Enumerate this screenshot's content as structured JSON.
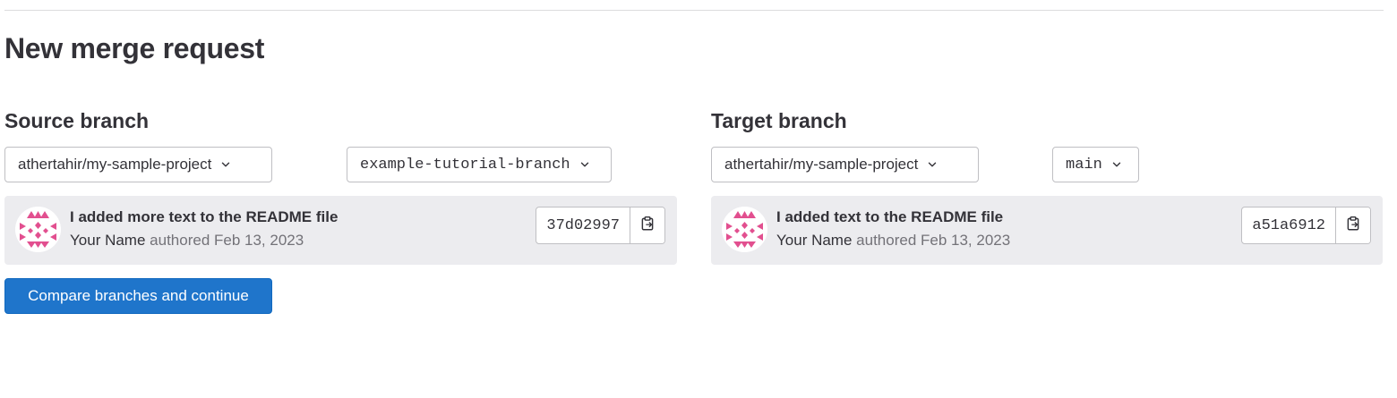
{
  "page": {
    "title": "New merge request"
  },
  "source": {
    "heading": "Source branch",
    "project": "athertahir/my-sample-project",
    "branch": "example-tutorial-branch",
    "commit": {
      "message": "I added more text to the README file",
      "author": "Your Name",
      "authored": "authored Feb 13, 2023",
      "sha": "37d02997"
    }
  },
  "target": {
    "heading": "Target branch",
    "project": "athertahir/my-sample-project",
    "branch": "main",
    "commit": {
      "message": "I added text to the README file",
      "author": "Your Name",
      "authored": "authored Feb 13, 2023",
      "sha": "a51a6912"
    }
  },
  "actions": {
    "compare_label": "Compare branches and continue"
  },
  "icons": {
    "chevron": "chevron-down-icon",
    "copy": "clipboard-copy-icon",
    "avatar": "identicon-avatar"
  },
  "colors": {
    "primary": "#1f75cb",
    "card_bg": "#ececef",
    "avatar_pink": "#e24f8f",
    "muted_text": "#737278"
  }
}
